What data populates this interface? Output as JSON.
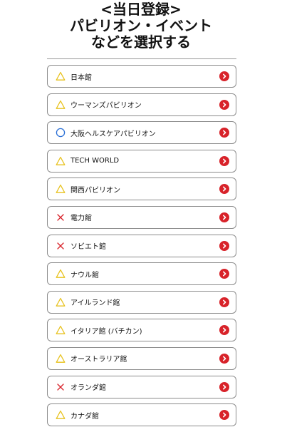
{
  "header": {
    "line1": "<当日登録>",
    "line2": "パビリオン・イベント",
    "line3": "などを選択する"
  },
  "colors": {
    "triangle": "#e8c21f",
    "circle": "#2a6fd6",
    "cross": "#d8232a",
    "chevron_bg": "#d8232a"
  },
  "pavilions": [
    {
      "name": "日本館",
      "status": "triangle"
    },
    {
      "name": "ウーマンズパビリオン",
      "status": "triangle"
    },
    {
      "name": "大阪ヘルスケアパビリオン",
      "status": "circle"
    },
    {
      "name": "TECH WORLD",
      "status": "triangle"
    },
    {
      "name": "関西パビリオン",
      "status": "triangle"
    },
    {
      "name": "電力館",
      "status": "cross"
    },
    {
      "name": "ソビエト館",
      "status": "cross"
    },
    {
      "name": "ナウル館",
      "status": "triangle"
    },
    {
      "name": "アイルランド館",
      "status": "triangle"
    },
    {
      "name": "イタリア館 (バチカン)",
      "status": "triangle"
    },
    {
      "name": "オーストラリア館",
      "status": "triangle"
    },
    {
      "name": "オランダ館",
      "status": "cross"
    },
    {
      "name": "カナダ館",
      "status": "triangle"
    }
  ]
}
